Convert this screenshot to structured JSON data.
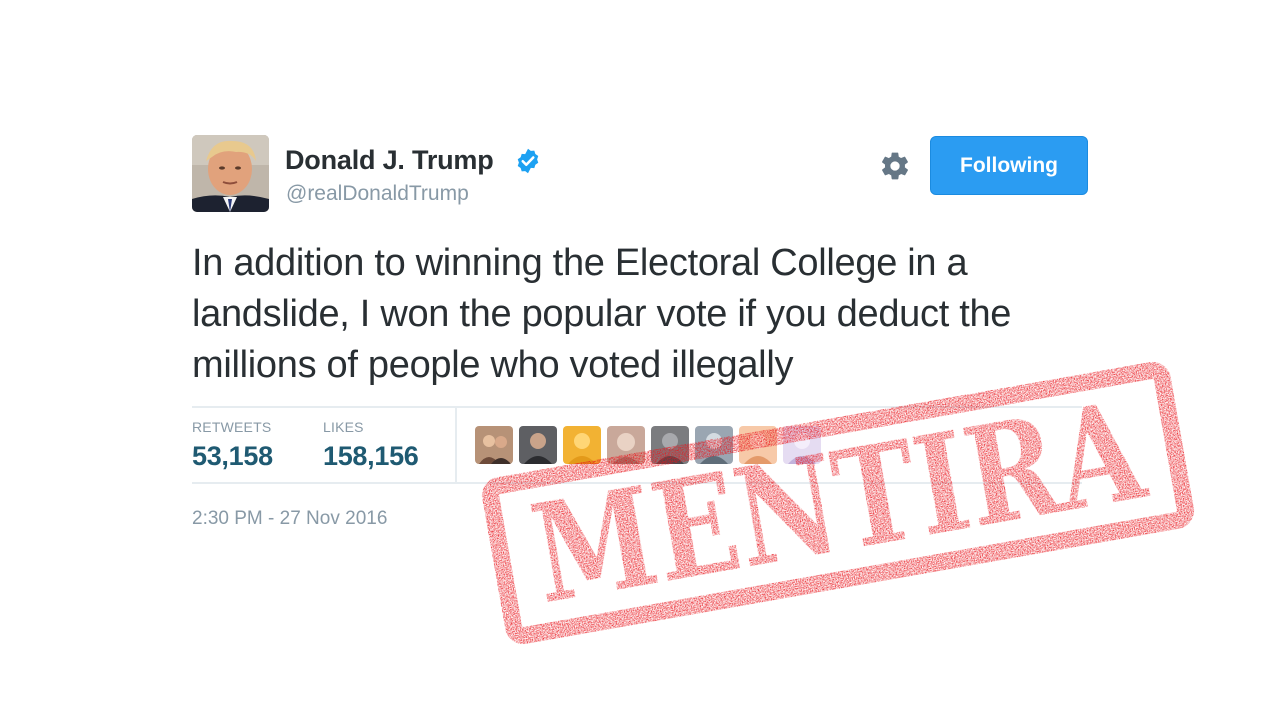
{
  "profile": {
    "display_name": "Donald J. Trump",
    "handle": "@realDonaldTrump",
    "verified": true
  },
  "actions": {
    "follow_label": "Following",
    "settings_icon": "gear-icon"
  },
  "tweet": {
    "text": "In addition to winning the Electoral College in a landslide, I won the popular vote if you deduct the millions of people who voted illegally",
    "timestamp": "2:30 PM - 27 Nov 2016"
  },
  "stats": {
    "retweets_label": "RETWEETS",
    "retweets_value": "53,158",
    "likes_label": "LIKES",
    "likes_value": "158,156"
  },
  "likers_count_shown": 8,
  "stamp": {
    "text": "MENTIRA",
    "color": "#e8141b"
  },
  "colors": {
    "follow_button": "#2b9cf2",
    "stat_value": "#1f5a72",
    "muted_text": "#8899a6",
    "verified_badge": "#1da1f2"
  }
}
